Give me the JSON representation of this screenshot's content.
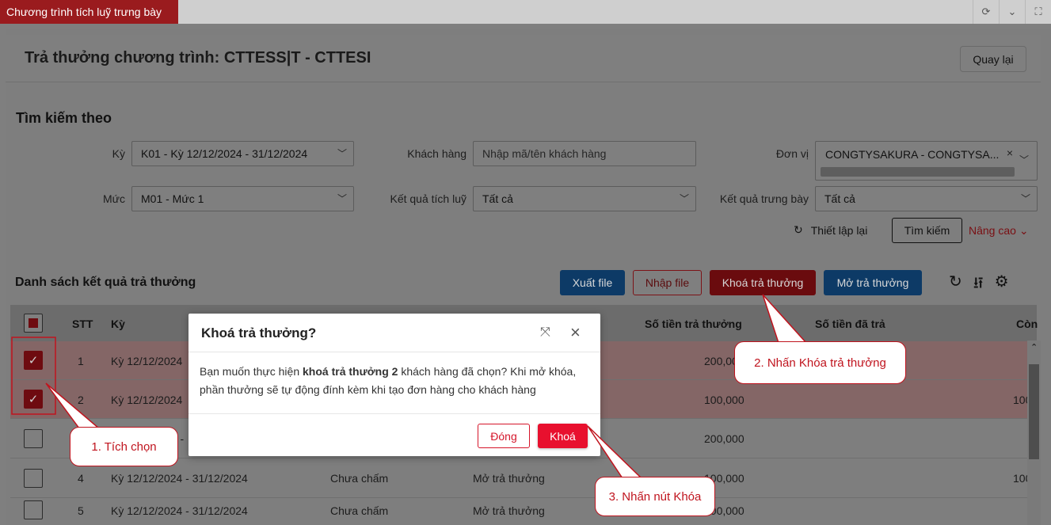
{
  "top_tab": {
    "label": "Chương trình tích luỹ trưng bày"
  },
  "top_icons": [
    "refresh-icon",
    "chevron-down-icon",
    "fullscreen-icon"
  ],
  "header": {
    "title": "Trả thưởng chương trình: CTTESS|T - CTTESI",
    "back_label": "Quay lại"
  },
  "search": {
    "title": "Tìm kiếm theo",
    "period_label": "Kỳ",
    "period_value": "K01 - Kỳ 12/12/2024 - 31/12/2024",
    "customer_label": "Khách hàng",
    "customer_placeholder": "Nhập mã/tên khách hàng",
    "unit_label": "Đơn vị",
    "unit_value": "CONGTYSAKURA - CONGTYSA...",
    "level_label": "Mức",
    "level_value": "M01 - Mức 1",
    "accum_label": "Kết quả tích luỹ",
    "accum_value": "Tất cả",
    "display_label": "Kết quả trưng bày",
    "display_value": "Tất cả",
    "reset_label": "Thiết lập lại",
    "search_label": "Tìm kiếm",
    "advanced_label": "Nâng cao"
  },
  "list": {
    "title": "Danh sách kết quả trả thưởng",
    "export_label": "Xuất file",
    "import_label": "Nhập file",
    "lock_label": "Khoá trả thưởng",
    "unlock_label": "Mở trả thưởng"
  },
  "table": {
    "headers": {
      "stt": "STT",
      "period": "Kỳ",
      "reward": "Số tiền trả thưởng",
      "paid": "Số tiền đã trả",
      "remain": "Còn"
    },
    "rows": [
      {
        "stt": "1",
        "period": "Kỳ 12/12/2024",
        "status": "",
        "pay": "",
        "reward": "200,000",
        "remain": "",
        "checked": true
      },
      {
        "stt": "2",
        "period": "Kỳ 12/12/2024",
        "status": "",
        "pay": "",
        "reward": "100,000",
        "remain": "100",
        "checked": true
      },
      {
        "stt": "",
        "period": "24 -",
        "status": "",
        "pay": "",
        "reward": "200,000",
        "remain": "",
        "checked": false
      },
      {
        "stt": "4",
        "period": "Kỳ 12/12/2024 - 31/12/2024",
        "status": "Chưa chấm",
        "pay": "Mở trả thưởng",
        "reward": "100,000",
        "remain": "100",
        "checked": false
      },
      {
        "stt": "5",
        "period": "Kỳ 12/12/2024 - 31/12/2024",
        "status": "Chưa chấm",
        "pay": "Mở trả thưởng",
        "reward": "100,000",
        "remain": "",
        "checked": false
      }
    ]
  },
  "modal": {
    "title": "Khoá trả thưởng?",
    "body_prefix": "Bạn muốn thực hiện ",
    "body_bold": "khoá trả thưởng 2",
    "body_suffix": " khách hàng đã chọn? Khi mở khóa, phần thưởng sẽ tự động đính kèm khi tạo đơn hàng cho khách hàng",
    "close_label": "Đóng",
    "lock_label": "Khoá"
  },
  "callouts": {
    "step1": "1. Tích chọn",
    "step2": "2. Nhấn Khóa trả thưởng",
    "step3": "3. Nhấn nút Khóa"
  },
  "colors": {
    "brand_red": "#c0141e",
    "lock_button": "#e8102e"
  }
}
